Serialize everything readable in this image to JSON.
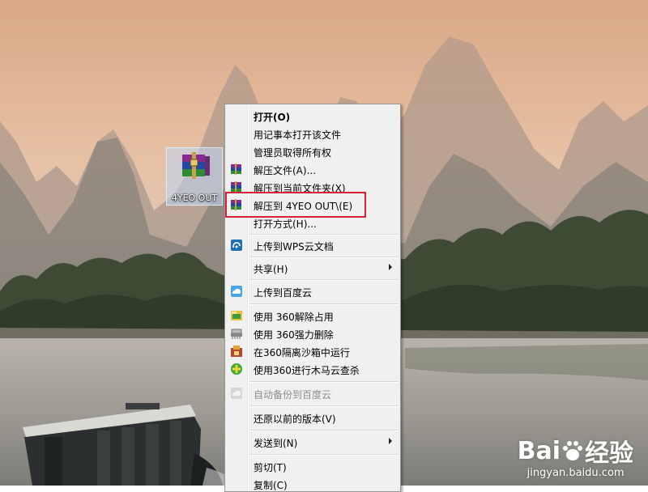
{
  "desktop": {
    "icon_label": "4YEO OUT",
    "icon_name": "winrar-archive-icon"
  },
  "context_menu": {
    "items": [
      {
        "label": "打开(O)",
        "bold": true,
        "icon": ""
      },
      {
        "label": "用记事本打开该文件",
        "icon": ""
      },
      {
        "label": "管理员取得所有权",
        "icon": ""
      },
      {
        "label": "解压文件(A)...",
        "icon": "winrar-icon"
      },
      {
        "label": "解压到当前文件夹(X)",
        "icon": "winrar-icon"
      },
      {
        "label": "解压到 4YEO OUT\\(E)",
        "icon": "winrar-icon",
        "highlighted": true
      },
      {
        "label": "打开方式(H)...",
        "icon": ""
      },
      {
        "label": "上传到WPS云文档",
        "icon": "wps-cloud-icon"
      },
      {
        "label": "共享(H)",
        "icon": "",
        "submenu": true
      },
      {
        "label": "上传到百度云",
        "icon": "baidu-cloud-icon"
      },
      {
        "label": "使用 360解除占用",
        "icon": "360-unlock-icon"
      },
      {
        "label": "使用 360强力删除",
        "icon": "360-shred-icon"
      },
      {
        "label": "在360隔离沙箱中运行",
        "icon": "360-sandbox-icon"
      },
      {
        "label": "使用360进行木马云查杀",
        "icon": "360-scan-icon"
      },
      {
        "label": "自动备份到百度云",
        "icon": "baidu-backup-icon",
        "disabled": true
      },
      {
        "label": "还原以前的版本(V)",
        "icon": ""
      },
      {
        "label": "发送到(N)",
        "icon": "",
        "submenu": true
      },
      {
        "label": "剪切(T)",
        "icon": ""
      },
      {
        "label": "复制(C)",
        "icon": ""
      }
    ],
    "highlight_color": "#d6203c"
  },
  "watermark": {
    "brand_prefix": "Bai",
    "brand_suffix": "经验",
    "site": "jingyan.baidu.com"
  }
}
